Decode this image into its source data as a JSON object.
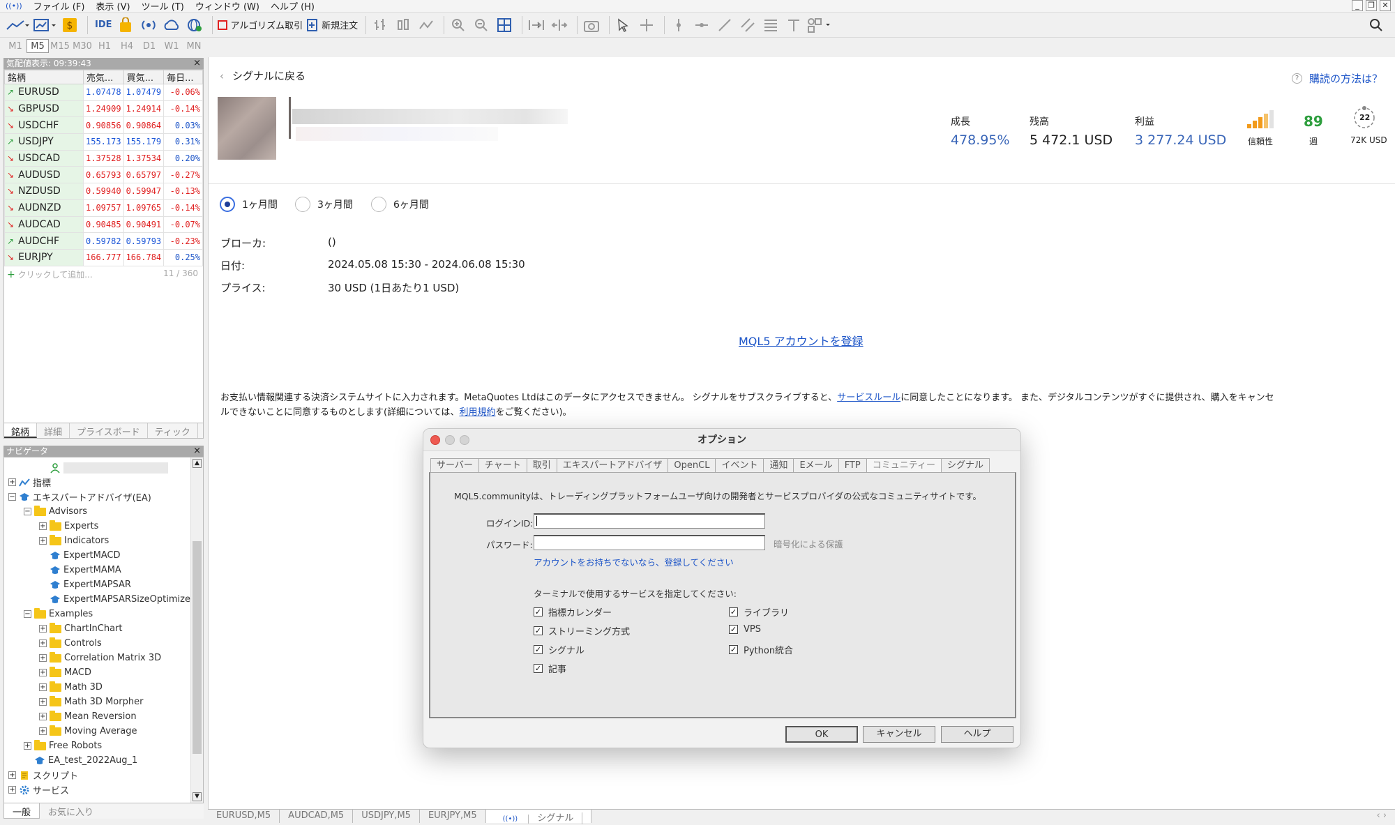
{
  "menu": [
    "ファイル (F)",
    "表示 (V)",
    "ツール (T)",
    "ウィンドウ (W)",
    "ヘルプ (H)"
  ],
  "toolbar": {
    "ide": "IDE",
    "algo": "アルゴリズム取引",
    "neworder": "新規注文"
  },
  "timeframes": [
    "M1",
    "M5",
    "M15",
    "M30",
    "H1",
    "H4",
    "D1",
    "W1",
    "MN"
  ],
  "timeframe_active": "M5",
  "market_watch": {
    "title": "気配値表示: 09:39:43",
    "headers": [
      "銘柄",
      "売気...",
      "買気...",
      "毎日..."
    ],
    "rows": [
      {
        "sym": "EURUSD",
        "bid": "1.07478",
        "ask": "1.07479",
        "chg": "-0.06%",
        "dir": "up"
      },
      {
        "sym": "GBPUSD",
        "bid": "1.24909",
        "ask": "1.24914",
        "chg": "-0.14%",
        "dir": "dn"
      },
      {
        "sym": "USDCHF",
        "bid": "0.90856",
        "ask": "0.90864",
        "chg": "0.03%",
        "dir": "dn"
      },
      {
        "sym": "USDJPY",
        "bid": "155.173",
        "ask": "155.179",
        "chg": "0.31%",
        "dir": "up"
      },
      {
        "sym": "USDCAD",
        "bid": "1.37528",
        "ask": "1.37534",
        "chg": "0.20%",
        "dir": "dn"
      },
      {
        "sym": "AUDUSD",
        "bid": "0.65793",
        "ask": "0.65797",
        "chg": "-0.27%",
        "dir": "dn"
      },
      {
        "sym": "NZDUSD",
        "bid": "0.59940",
        "ask": "0.59947",
        "chg": "-0.13%",
        "dir": "dn"
      },
      {
        "sym": "AUDNZD",
        "bid": "1.09757",
        "ask": "1.09765",
        "chg": "-0.14%",
        "dir": "dn"
      },
      {
        "sym": "AUDCAD",
        "bid": "0.90485",
        "ask": "0.90491",
        "chg": "-0.07%",
        "dir": "dn"
      },
      {
        "sym": "AUDCHF",
        "bid": "0.59782",
        "ask": "0.59793",
        "chg": "-0.23%",
        "dir": "up"
      },
      {
        "sym": "EURJPY",
        "bid": "166.777",
        "ask": "166.784",
        "chg": "0.25%",
        "dir": "dn"
      }
    ],
    "add": "クリックして追加...",
    "count": "11 / 360",
    "tabs": [
      "銘柄",
      "詳細",
      "プライスボード",
      "ティック"
    ]
  },
  "navigator": {
    "title": "ナビゲータ",
    "items": [
      {
        "label": "",
        "type": "user",
        "indent": 3
      },
      {
        "label": "指標",
        "type": "ind",
        "indent": 1,
        "exp": "+"
      },
      {
        "label": "エキスパートアドバイザ(EA)",
        "type": "ea",
        "indent": 1,
        "exp": "-"
      },
      {
        "label": "Advisors",
        "type": "folder",
        "indent": 2,
        "exp": "-"
      },
      {
        "label": "Experts",
        "type": "folder",
        "indent": 3,
        "exp": "+"
      },
      {
        "label": "Indicators",
        "type": "folder",
        "indent": 3,
        "exp": "+"
      },
      {
        "label": "ExpertMACD",
        "type": "ea",
        "indent": 3
      },
      {
        "label": "ExpertMAMA",
        "type": "ea",
        "indent": 3
      },
      {
        "label": "ExpertMAPSAR",
        "type": "ea",
        "indent": 3
      },
      {
        "label": "ExpertMAPSARSizeOptimize",
        "type": "ea",
        "indent": 3
      },
      {
        "label": "Examples",
        "type": "folder",
        "indent": 2,
        "exp": "-"
      },
      {
        "label": "ChartInChart",
        "type": "folder",
        "indent": 3,
        "exp": "+"
      },
      {
        "label": "Controls",
        "type": "folder",
        "indent": 3,
        "exp": "+"
      },
      {
        "label": "Correlation Matrix 3D",
        "type": "folder",
        "indent": 3,
        "exp": "+"
      },
      {
        "label": "MACD",
        "type": "folder",
        "indent": 3,
        "exp": "+"
      },
      {
        "label": "Math 3D",
        "type": "folder",
        "indent": 3,
        "exp": "+"
      },
      {
        "label": "Math 3D Morpher",
        "type": "folder",
        "indent": 3,
        "exp": "+"
      },
      {
        "label": "Mean Reversion",
        "type": "folder",
        "indent": 3,
        "exp": "+"
      },
      {
        "label": "Moving Average",
        "type": "folder",
        "indent": 3,
        "exp": "+"
      },
      {
        "label": "Free Robots",
        "type": "folder",
        "indent": 2,
        "exp": "+"
      },
      {
        "label": "EA_test_2022Aug_1",
        "type": "ea",
        "indent": 2
      },
      {
        "label": "スクリプト",
        "type": "script",
        "indent": 1,
        "exp": "+"
      },
      {
        "label": "サービス",
        "type": "service",
        "indent": 1,
        "exp": "+"
      }
    ],
    "tabs": [
      "一般",
      "お気に入り"
    ]
  },
  "signal": {
    "back": "シグナルに戻る",
    "howto": "購読の方法は？",
    "growth_label": "成長",
    "growth": "478.95%",
    "balance_label": "残高",
    "balance": "5 472.1 USD",
    "profit_label": "利益",
    "profit": "3 277.24 USD",
    "reliability": "信頼性",
    "weeks": "89",
    "weeks_label": "週",
    "subs": "22",
    "subs_money": "72K USD",
    "periods": [
      "1ヶ月間",
      "3ヶ月間",
      "6ヶ月間"
    ],
    "broker_label": "ブローカ:",
    "broker": "()",
    "date_label": "日付:",
    "date": "2024.05.08 15:30 - 2024.06.08 15:30",
    "price_label": "プライス:",
    "price": "30 USD (1日あたり1 USD)",
    "register": "MQL5 アカウントを登録",
    "disclaimer1": "お支払い情報関連する決済システムサイトに入力されます。MetaQuotes Ltdはこのデータにアクセスできません。 シグナルをサブスクライブすると、",
    "rules_link": "サービスルール",
    "disclaimer2": "に同意したことになります。 また、デジタルコンテンツがすぐに提供され、購入をキャンセ",
    "disclaimer3": "ルできないことに同意するものとします(詳細については、",
    "terms_link": "利用規約",
    "disclaimer4": "をご覧ください)。"
  },
  "bottom_tabs": [
    "EURUSD,M5",
    "AUDCAD,M5",
    "USDJPY,M5",
    "EURJPY,M5",
    "シグナル"
  ],
  "dialog": {
    "title": "オプション",
    "tabs": [
      "サーバー",
      "チャート",
      "取引",
      "エキスパートアドバイザ",
      "OpenCL",
      "イベント",
      "通知",
      "Eメール",
      "FTP",
      "コミュニティー",
      "シグナル"
    ],
    "intro": "MQL5.communityは、トレーディングプラットフォームユーザ向けの開発者とサービスプロバイダの公式なコミュニティサイトです。",
    "login_label": "ログインID:",
    "login_value": "",
    "password_label": "パスワード:",
    "password_value": "",
    "encrypt": "暗号化による保護",
    "register_link": "アカウントをお持ちでないなら、登録してください",
    "services_label": "ターミナルで使用するサービスを指定してください:",
    "services": [
      {
        "label": "指標カレンダー",
        "checked": true
      },
      {
        "label": "ストリーミング方式",
        "checked": true
      },
      {
        "label": "シグナル",
        "checked": true
      },
      {
        "label": "記事",
        "checked": true
      },
      {
        "label": "ライブラリ",
        "checked": true
      },
      {
        "label": "VPS",
        "checked": true
      },
      {
        "label": "Python統合",
        "checked": true
      }
    ],
    "ok": "OK",
    "cancel": "キャンセル",
    "help": "ヘルプ"
  },
  "colors": {
    "accent": "#1d55c8",
    "green": "#2e9e3e",
    "orange": "#f29a1a",
    "red": "#e02020",
    "link": "#1d55c8"
  }
}
